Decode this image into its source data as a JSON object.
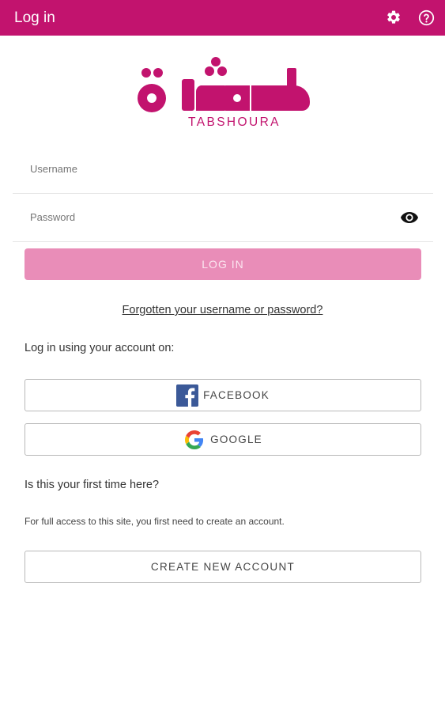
{
  "header": {
    "title": "Log in",
    "settings_icon": "gear-icon",
    "help_icon": "question-circle-icon",
    "background_color": "#c2136e"
  },
  "logo": {
    "brand_text": "TABSHOURA",
    "brand_color": "#c2136e"
  },
  "form": {
    "username_placeholder": "Username",
    "username_value": "",
    "password_placeholder": "Password",
    "password_value": "",
    "show_password_icon": "eye-icon",
    "login_label": "LOG IN",
    "login_button_color": "#e98db8",
    "forgot_link": "Forgotten your username or password?"
  },
  "oauth": {
    "heading": "Log in using your account on:",
    "facebook_label": "FACEBOOK",
    "facebook_icon": "facebook-icon",
    "google_label": "GOOGLE",
    "google_icon": "google-icon"
  },
  "signup": {
    "heading": "Is this your first time here?",
    "description": "For full access to this site, you first need to create an account.",
    "create_label": "CREATE NEW ACCOUNT"
  }
}
